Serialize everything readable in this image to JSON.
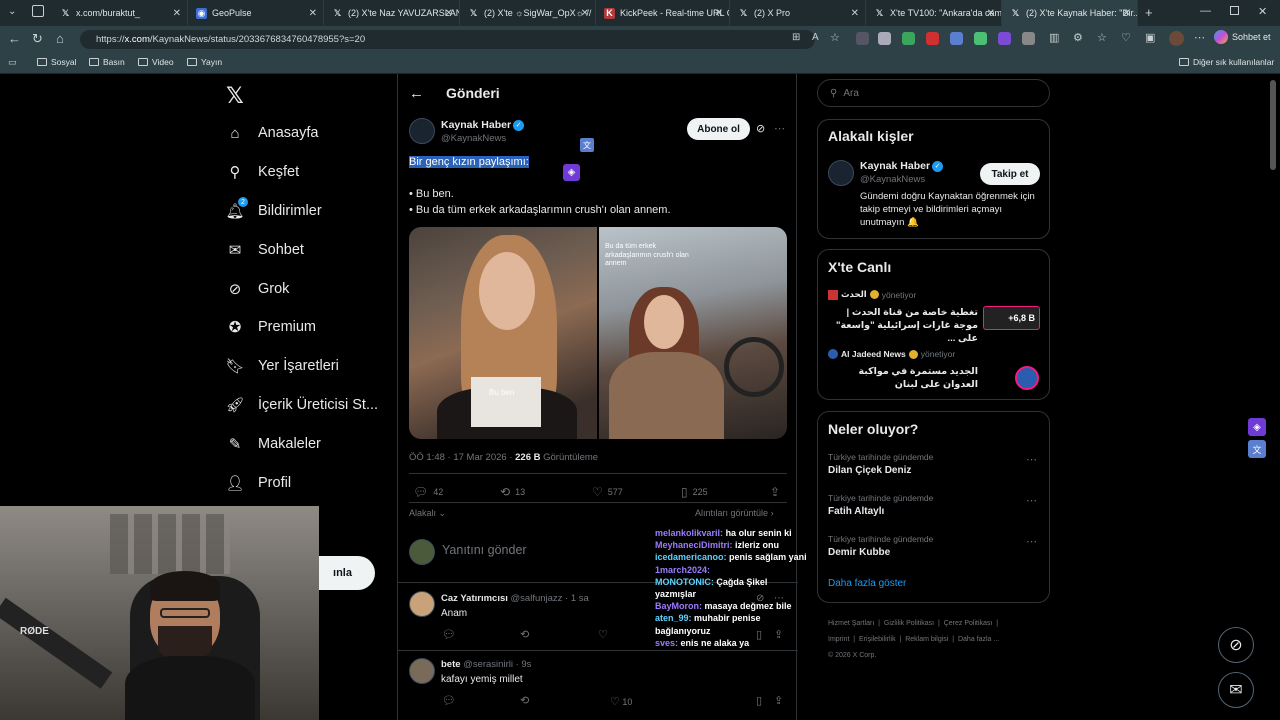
{
  "browser": {
    "tabs": [
      {
        "label": "x.com/buraktut_",
        "icon": "x-icon"
      },
      {
        "label": "GeoPulse",
        "icon": "globe-icon"
      },
      {
        "label": "(2) X'te Naz YAVUZARSLAN...",
        "icon": "x-icon"
      },
      {
        "label": "(2) X'te ☼SigWar_OpX☼ //",
        "icon": "x-icon"
      },
      {
        "label": "KickPeek - Real-time URL C...",
        "icon": "kickpeek-icon"
      },
      {
        "label": "(2) X Pro",
        "icon": "x-icon"
      },
      {
        "label": "X'te TV100: \"Ankara'da cam...",
        "icon": "x-icon"
      },
      {
        "label": "(2) X'te Kaynak Haber: \"Bir...",
        "icon": "x-icon"
      }
    ],
    "url_prefix": "https://",
    "url_host": "x.com",
    "url_path": "/KaynakNews/status/2033676834760478955?s=20",
    "chat_label": "Sohbet et",
    "bookmarks": [
      "Sosyal",
      "Basın",
      "Video",
      "Yayın"
    ],
    "other_bookmarks": "Diğer sık kullanılanlar"
  },
  "sidebar": {
    "items": [
      {
        "label": "Anasayfa",
        "icon": "home-icon"
      },
      {
        "label": "Keşfet",
        "icon": "search-icon"
      },
      {
        "label": "Bildirimler",
        "icon": "bell-icon",
        "badge": "2"
      },
      {
        "label": "Sohbet",
        "icon": "mail-icon"
      },
      {
        "label": "Grok",
        "icon": "grok-icon"
      },
      {
        "label": "Premium",
        "icon": "premium-icon"
      },
      {
        "label": "Yer İşaretleri",
        "icon": "bookmark-icon"
      },
      {
        "label": "İçerik Üreticisi St...",
        "icon": "rocket-icon"
      },
      {
        "label": "Makaleler",
        "icon": "articles-icon"
      },
      {
        "label": "Profil",
        "icon": "profile-icon"
      }
    ],
    "post_button_fragment": "ınla"
  },
  "main": {
    "header_title": "Gönderi",
    "tweet": {
      "author_name": "Kaynak Haber",
      "author_handle": "@KaynakNews",
      "follow_label": "Abone ol",
      "text_selected": "Bir genç kızın paylaşımı:",
      "line1": "• Bu ben.",
      "line2": "• Bu da tüm erkek arkadaşlarımın crush'ı olan annem.",
      "media_left_caption": "Bu ben",
      "media_right_caption": "Bu da tüm erkek arkadaşlarımın crush'ı olan annem",
      "time": "ÖÖ 1:48 · 17 Mar 2026 · ",
      "views_value": "226 B",
      "views_label": " Görüntüleme",
      "replies": "42",
      "retweets": "13",
      "likes": "577",
      "bookmarks": "225"
    },
    "sort_label": "Alakalı",
    "quotes_label": "Alıntıları görüntüle",
    "reply_placeholder": "Yanıtını gönder",
    "replies": [
      {
        "name": "Caz Yatırımcısı",
        "handle": "@salfunjazz · 1 sa",
        "text": "Anam",
        "likes": ""
      },
      {
        "name": "bete",
        "handle": "@serasinirli · 9s",
        "text": "kafayı yemiş millet",
        "likes": "10"
      }
    ]
  },
  "right": {
    "search_placeholder": "Ara",
    "related_title": "Alakalı kişler",
    "related_name": "Kaynak Haber",
    "related_handle": "@KaynakNews",
    "related_follow": "Takip et",
    "related_bio": "Gündemi doğru Kaynaktan öğrenmek için takip etmeyi ve bildirimleri açmayı unutmayın 🔔",
    "live_title": "X'te Canlı",
    "live": [
      {
        "host": "الحدث",
        "status": "yönetiyor",
        "text": "تغطية خاصة من قناة الحدث | موجة غارات إسرائيلية \"واسعة\" على ...",
        "count": "+6,8 B"
      },
      {
        "host": "Al Jadeed News",
        "status": "yönetiyor",
        "text": "الجديد مستمرة في مواكبة العدوان على لبنان",
        "count": ""
      }
    ],
    "trends_title": "Neler oluyor?",
    "trends": [
      {
        "context": "Türkiye tarihinde gündemde",
        "title": "Dilan Çiçek Deniz"
      },
      {
        "context": "Türkiye tarihinde gündemde",
        "title": "Fatih Altaylı"
      },
      {
        "context": "Türkiye tarihinde gündemde",
        "title": "Demir Kubbe"
      }
    ],
    "show_more": "Daha fazla göster",
    "footer_line1": [
      "Hizmet Şartları",
      "Gizlilik Politikası",
      "Çerez Politikası"
    ],
    "footer_line2": [
      "Imprint",
      "Erişilebilirlik",
      "Reklam bilgisi",
      "Daha fazla ..."
    ],
    "copyright": "© 2026 X Corp."
  },
  "overlay_chat": [
    {
      "user": "melankolikvaril:",
      "msg": "ha olur senin ki"
    },
    {
      "user": "MeyhaneciDimitri:",
      "msg": "izleriz onu"
    },
    {
      "user": "icedamericanoo:",
      "msg": "penis sağlam yani"
    },
    {
      "user": "1march2024:",
      "msg": ""
    },
    {
      "user": "MONOTONIC:",
      "msg": "Çağda Şikel yazmışlar"
    },
    {
      "user": "BayMoron:",
      "msg": "masaya değmez bile"
    },
    {
      "user": "aten_99:",
      "msg": "muhabir penise bağlanıyoruz"
    },
    {
      "user": "sves:",
      "msg": "enis ne alaka ya"
    }
  ],
  "webcam": {
    "mic_brand": "RØDE"
  }
}
